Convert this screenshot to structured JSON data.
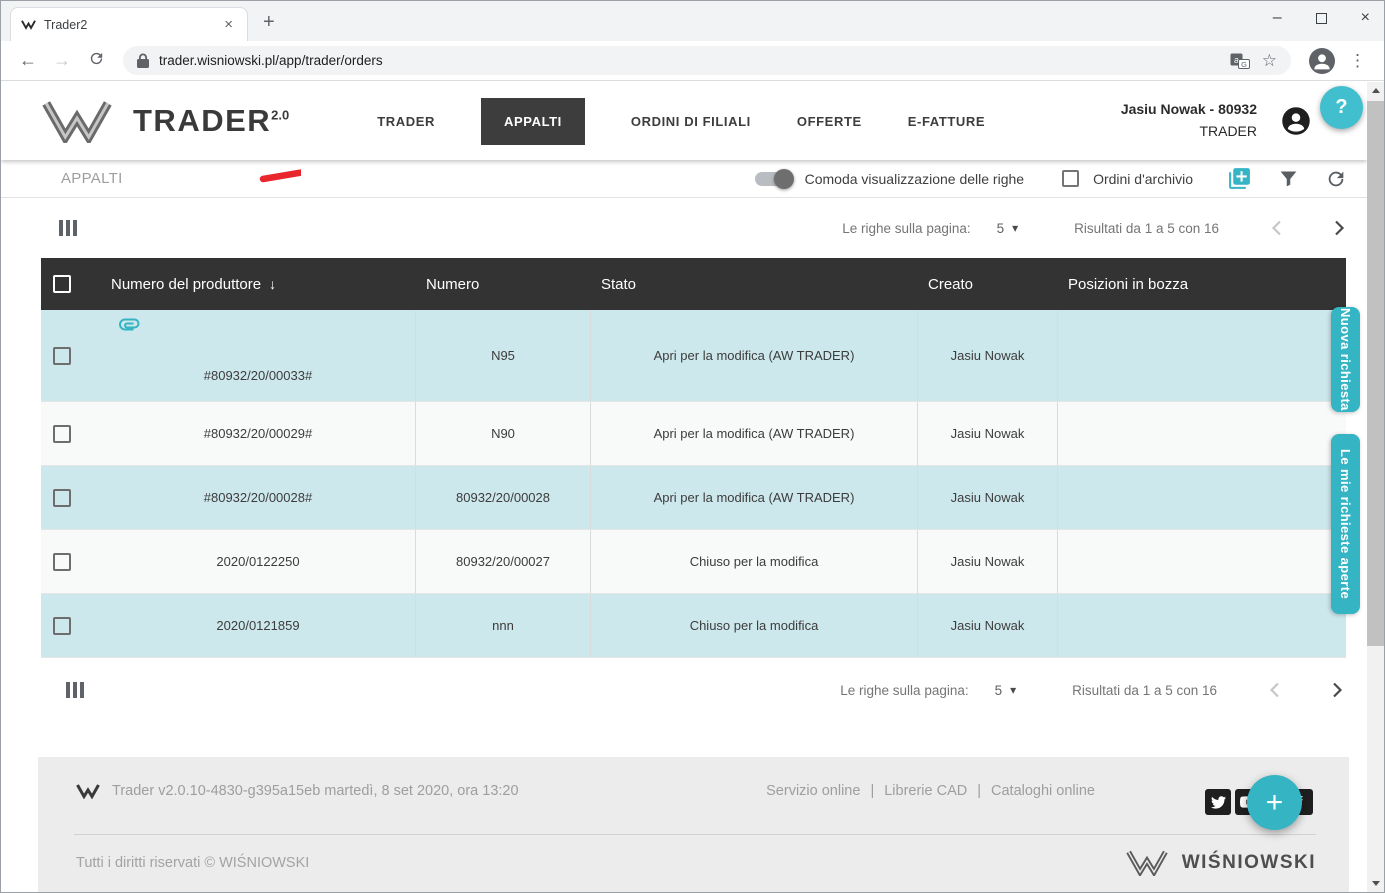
{
  "browser": {
    "tab_title": "Trader2",
    "url": "trader.wisniowski.pl/app/trader/orders"
  },
  "icons": {
    "back": "←",
    "forward": "→",
    "star": "☆",
    "menu_dots": "⋮",
    "minimize": "–",
    "close": "×",
    "tab_close": "×",
    "new_tab": "+",
    "caret_down": "▾",
    "sort_desc": "↓",
    "help": "?",
    "plus": "+",
    "facebook_glyph": "f"
  },
  "header": {
    "logo_text": "TRADER",
    "logo_version": "2.0",
    "nav": [
      {
        "label": "TRADER",
        "active": false
      },
      {
        "label": "APPALTI",
        "active": true
      },
      {
        "label": "ORDINI DI FILIALI",
        "active": false
      },
      {
        "label": "OFFERTE",
        "active": false
      },
      {
        "label": "E-FATTURE",
        "active": false
      }
    ],
    "user_name": "Jasiu Nowak - 80932",
    "user_role": "TRADER"
  },
  "toolbar": {
    "breadcrumb": "APPALTI",
    "toggle_label": "Comoda visualizzazione delle righe",
    "archive_checkbox_label": "Ordini d'archivio"
  },
  "pagination": {
    "rows_per_page_label": "Le righe sulla pagina:",
    "rows_per_page_value": "5",
    "results_text": "Risultati da 1 a 5 con 16"
  },
  "table": {
    "columns": [
      "Numero del produttore",
      "Numero",
      "Stato",
      "Creato",
      "Posizioni in bozza"
    ],
    "rows": [
      {
        "producer_number": "#80932/20/00033#",
        "number": "N95",
        "status": "Apri per la modifica (AW TRADER)",
        "created_by": "Jasiu Nowak",
        "draft_positions": "",
        "has_attachment": true
      },
      {
        "producer_number": "#80932/20/00029#",
        "number": "N90",
        "status": "Apri per la modifica (AW TRADER)",
        "created_by": "Jasiu Nowak",
        "draft_positions": "",
        "has_attachment": false
      },
      {
        "producer_number": "#80932/20/00028#",
        "number": "80932/20/00028",
        "status": "Apri per la modifica (AW TRADER)",
        "created_by": "Jasiu Nowak",
        "draft_positions": "",
        "has_attachment": false
      },
      {
        "producer_number": "2020/0122250",
        "number": "80932/20/00027",
        "status": "Chiuso per la modifica",
        "created_by": "Jasiu Nowak",
        "draft_positions": "",
        "has_attachment": false
      },
      {
        "producer_number": "2020/0121859",
        "number": "nnn",
        "status": "Chiuso per la modifica",
        "created_by": "Jasiu Nowak",
        "draft_positions": "",
        "has_attachment": false
      }
    ]
  },
  "side_tabs": [
    {
      "label": "Nuova richiesta"
    },
    {
      "label": "Le mie richieste aperte"
    }
  ],
  "footer": {
    "version_text": "Trader v2.0.10-4830-g395a15eb martedì, 8 set 2020, ora 13:20",
    "links": [
      "Servizio online",
      "Librerie CAD",
      "Cataloghi online"
    ],
    "link_separator": "|",
    "copyright": "Tutti i diritti riservati © WIŚNIOWSKI",
    "brand_name": "WIŚNIOWSKI"
  },
  "colors": {
    "accent_teal": "#35b4c4",
    "table_header_bg": "#333333",
    "row_highlight": "#cde8ec",
    "nav_active_bg": "#3d3d3d",
    "annotation_arrow": "#e8262b"
  }
}
